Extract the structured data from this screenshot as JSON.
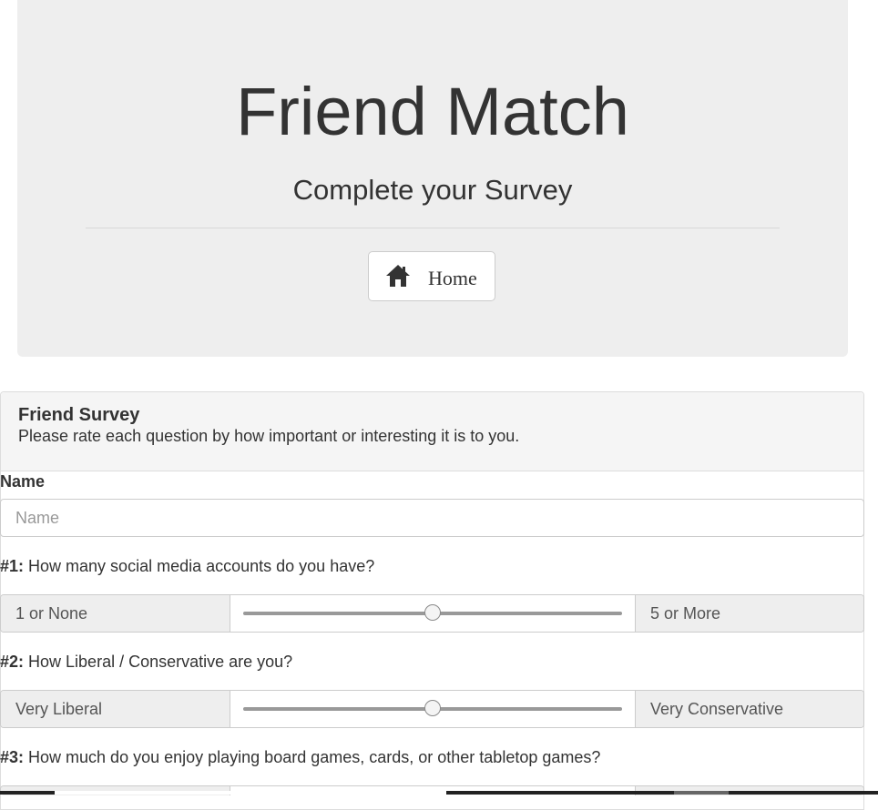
{
  "header": {
    "title": "Friend Match",
    "subtitle": "Complete your Survey",
    "home_button": {
      "label": "Home",
      "icon": "home-icon"
    }
  },
  "survey": {
    "title": "Friend Survey",
    "description": "Please rate each question by how important or interesting it is to you.",
    "name_label": "Name",
    "name_placeholder": "Name",
    "name_value": "",
    "questions": [
      {
        "number": "#1:",
        "text": "How many social media accounts do you have?",
        "min_label": "1 or None",
        "max_label": "5 or More",
        "value_fraction": 0.5
      },
      {
        "number": "#2:",
        "text": "How Liberal / Conservative are you?",
        "min_label": "Very Liberal",
        "max_label": "Very Conservative",
        "value_fraction": 0.5
      },
      {
        "number": "#3:",
        "text": "How much do you enjoy playing board games, cards, or other tabletop games?"
      }
    ]
  },
  "colors": {
    "jumbotron_bg": "#eeeeee",
    "panel_heading_bg": "#f5f5f5",
    "addon_bg": "#eeeeee",
    "track": "#999999",
    "text": "#333333"
  }
}
